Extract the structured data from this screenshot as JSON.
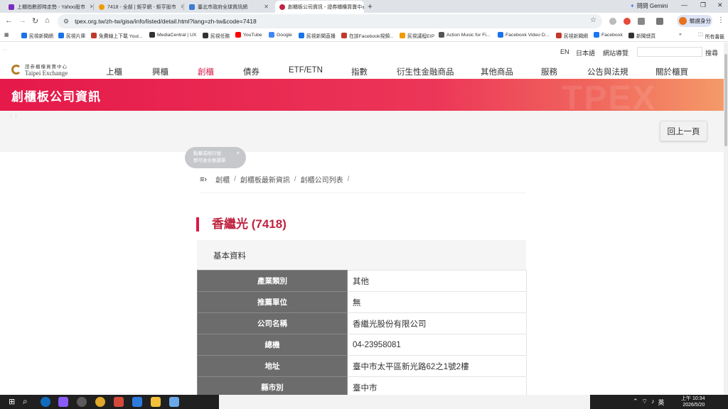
{
  "browser": {
    "tabs": [
      {
        "title": "上櫃指數即時走勢 - Yahoo股市",
        "fav": "#7b2bbf"
      },
      {
        "title": "7418 - 全部 | 鉅亨網 - 鉅亨股市",
        "fav": "#f29900"
      },
      {
        "title": "臺北市政府全球資訊網",
        "fav": "#3b7bd4"
      },
      {
        "title": "創櫃板公司資訊 - 證券櫃檯買賣中心",
        "fav": "#c0233f"
      }
    ],
    "new_tab": "+",
    "gemini_label": "問問 Gemini",
    "url": "tpex.org.tw/zh-tw/gisa/info/listed/detail.html?lang=zh-tw&code=7418",
    "profile_label": "驗證身分",
    "bookmarks": [
      {
        "label": "民視新聞網",
        "color": "#1a73e8"
      },
      {
        "label": "民視片庫",
        "color": "#1a73e8"
      },
      {
        "label": "免費線上下載 Yout...",
        "color": "#c0392b"
      },
      {
        "label": "MediaCentral | UX",
        "color": "#333333"
      },
      {
        "label": "民視任務",
        "color": "#333333"
      },
      {
        "label": "YouTube",
        "color": "#ff0000"
      },
      {
        "label": "Google",
        "color": "#4285f4"
      },
      {
        "label": "民視新聞直播",
        "color": "#1a73e8"
      },
      {
        "label": "在該Facebook視頻...",
        "color": "#c0392b"
      },
      {
        "label": "民視議程EIP",
        "color": "#f29900"
      },
      {
        "label": "Action Music for Fi...",
        "color": "#555555"
      },
      {
        "label": "Facebook Video D...",
        "color": "#1a73e8"
      },
      {
        "label": "民視新聞網",
        "color": "#c0392b"
      },
      {
        "label": "Facebook",
        "color": "#1877f2"
      },
      {
        "label": "新聞總頁",
        "color": "#333333"
      }
    ],
    "bookmarks_more": "»",
    "all_bookmarks": "所有書籤"
  },
  "site": {
    "util_links": [
      "EN",
      "日本語",
      "網站導覽"
    ],
    "search_label": "搜尋",
    "logo_line1": "證券櫃檯買賣中心",
    "logo_line2": "Taipei Exchange",
    "nav": [
      "上櫃",
      "興櫃",
      "創櫃",
      "債券",
      "ETF/ETN",
      "指數",
      "衍生性金融商品",
      "其他商品",
      "服務",
      "公告與法規",
      "關於櫃買"
    ],
    "active_nav": "創櫃",
    "banner_title": "創櫃板公司資訊",
    "banner_watermark": "TPEX",
    "back_button": "回上一頁",
    "tooltip_line1": "點擊或按行號",
    "tooltip_line2": "即可收合側選單",
    "breadcrumb": [
      "創櫃",
      "創櫃板最新資訊",
      "創櫃公司列表"
    ],
    "company_title": "香繼光 (7418)",
    "section_title": "基本資料",
    "rows": [
      {
        "key": "產業類別",
        "value": "其他"
      },
      {
        "key": "推薦單位",
        "value": "無"
      },
      {
        "key": "公司名稱",
        "value": "香繼光股份有限公司"
      },
      {
        "key": "總機",
        "value": "04-23958081"
      },
      {
        "key": "地址",
        "value": "臺中市太平區新光路62之1號2樓"
      },
      {
        "key": "縣市別",
        "value": "臺中市"
      }
    ]
  },
  "taskbar": {
    "ime": "英",
    "time": "上午 10:34",
    "date": "2026/5/20"
  }
}
